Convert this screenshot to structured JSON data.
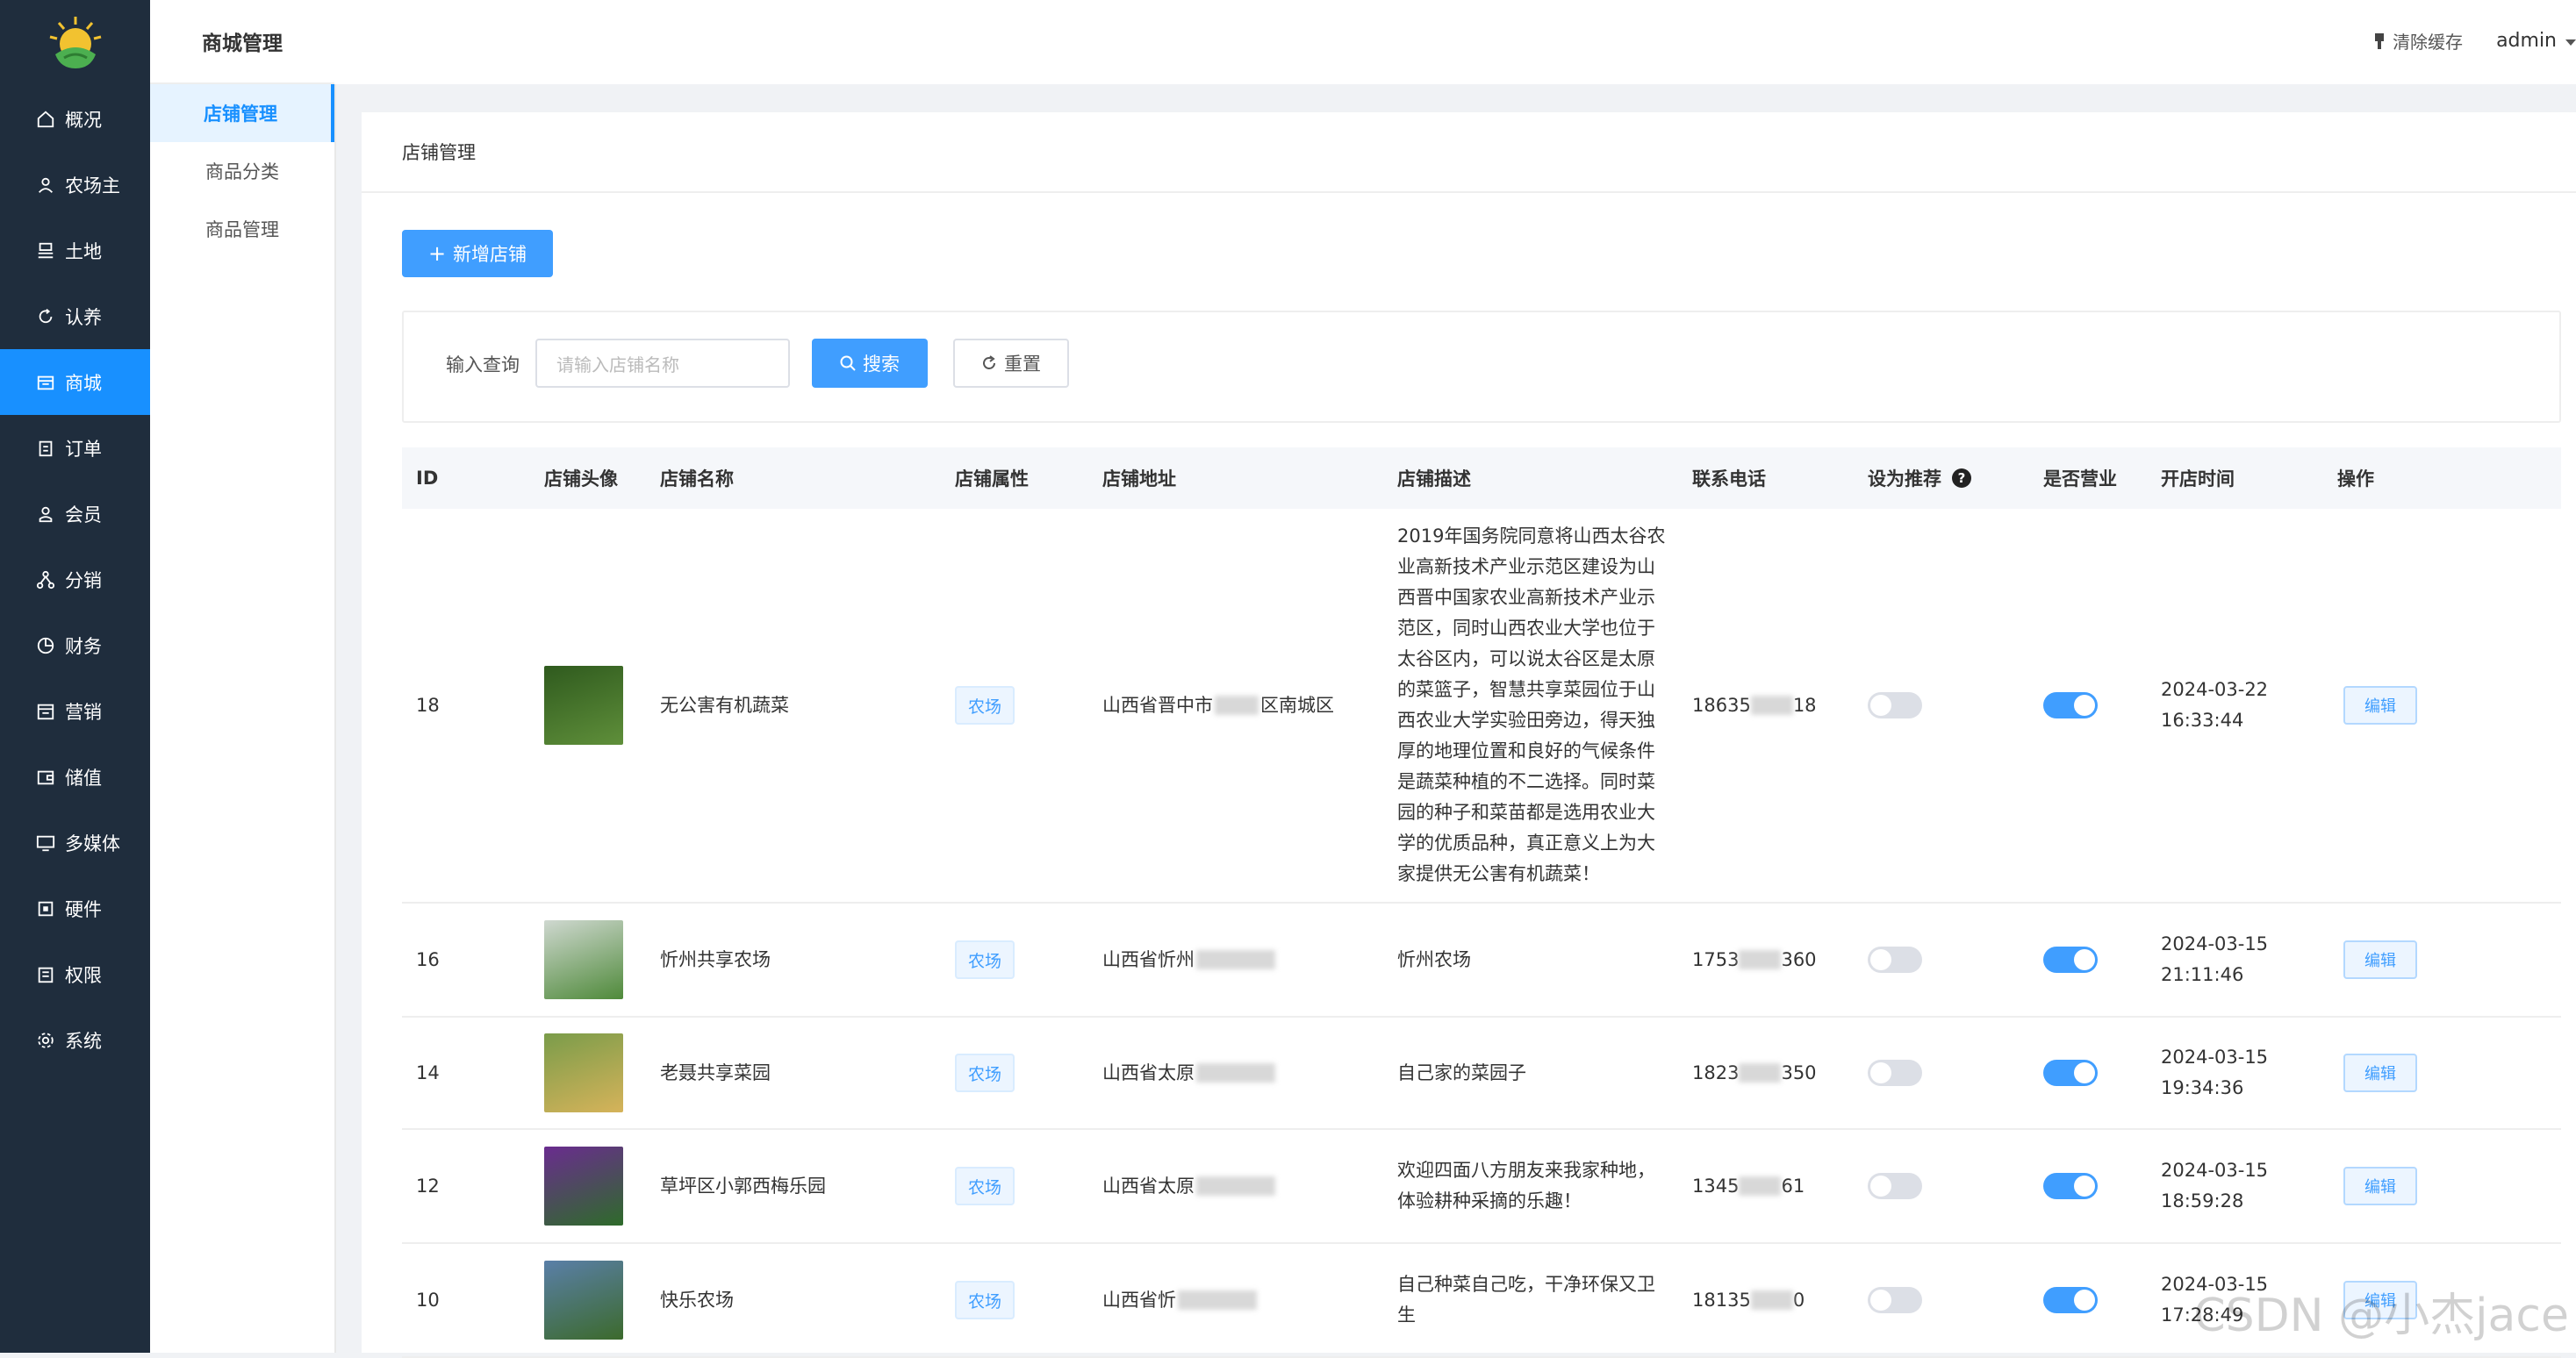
{
  "sidebar": {
    "items": [
      {
        "label": "概况",
        "icon": "home-icon"
      },
      {
        "label": "农场主",
        "icon": "user-icon"
      },
      {
        "label": "土地",
        "icon": "land-icon"
      },
      {
        "label": "认养",
        "icon": "refresh-icon"
      },
      {
        "label": "商城",
        "icon": "shop-icon",
        "active": true
      },
      {
        "label": "订单",
        "icon": "clipboard-icon"
      },
      {
        "label": "会员",
        "icon": "member-icon"
      },
      {
        "label": "分销",
        "icon": "share-icon"
      },
      {
        "label": "财务",
        "icon": "pie-icon"
      },
      {
        "label": "营销",
        "icon": "calendar-icon"
      },
      {
        "label": "储值",
        "icon": "wallet-icon"
      },
      {
        "label": "多媒体",
        "icon": "monitor-icon"
      },
      {
        "label": "硬件",
        "icon": "hardware-icon"
      },
      {
        "label": "权限",
        "icon": "lock-icon"
      },
      {
        "label": "系统",
        "icon": "gear-icon"
      }
    ]
  },
  "subnav": {
    "title": "商城管理",
    "items": [
      {
        "label": "店铺管理",
        "active": true
      },
      {
        "label": "商品分类"
      },
      {
        "label": "商品管理"
      }
    ]
  },
  "topbar": {
    "clear_cache": "清除缓存",
    "user": "admin"
  },
  "page": {
    "title": "店铺管理",
    "add_button": "新增店铺",
    "search": {
      "label": "输入查询",
      "placeholder": "请输入店铺名称",
      "search_button": "搜索",
      "reset_button": "重置"
    }
  },
  "table": {
    "headers": {
      "id": "ID",
      "avatar": "店铺头像",
      "name": "店铺名称",
      "attr": "店铺属性",
      "address": "店铺地址",
      "desc": "店铺描述",
      "phone": "联系电话",
      "recommend": "设为推荐",
      "open": "是否营业",
      "time": "开店时间",
      "ops": "操作"
    },
    "rows": [
      {
        "id": "18",
        "name": "无公害有机蔬菜",
        "attr": "农场",
        "address": "山西省晋中市",
        "address_tail": "区南城区",
        "desc_lines": [
          "2019年国务院同意将山西太谷农",
          "业高新技术产业示范区建设为山",
          "西晋中国家农业高新技术产业示",
          "范区，同时山西农业大学也位于",
          "太谷区内，可以说太谷区是太原",
          "的菜篮子，智慧共享菜园位于山",
          "西农业大学实验田旁边，得天独",
          "厚的地理位置和良好的气候条件",
          "是蔬菜种植的不二选择。同时菜",
          "园的种子和菜苗都是选用农业大",
          "学的优质品种，真正意义上为大",
          "家提供无公害有机蔬菜！"
        ],
        "phone_a": "18635",
        "phone_b": "18",
        "recommend": false,
        "open": true,
        "date": "2024-03-22",
        "time": "16:33:44",
        "edit": "编辑",
        "thumb": [
          "#2f5a1e",
          "#5f8f3a"
        ]
      },
      {
        "id": "16",
        "name": "忻州共享农场",
        "attr": "农场",
        "address": "山西省忻州",
        "address_tail": "",
        "desc_lines": [
          "忻州农场"
        ],
        "phone_a": "1753",
        "phone_b": "360",
        "recommend": false,
        "open": true,
        "date": "2024-03-15",
        "time": "21:11:46",
        "edit": "编辑",
        "thumb": [
          "#cfd8d0",
          "#4f8a3a"
        ]
      },
      {
        "id": "14",
        "name": "老聂共享菜园",
        "attr": "农场",
        "address": "山西省太原",
        "address_tail": "",
        "desc_lines": [
          "自己家的菜园子"
        ],
        "phone_a": "1823",
        "phone_b": "350",
        "recommend": false,
        "open": true,
        "date": "2024-03-15",
        "time": "19:34:36",
        "edit": "编辑",
        "thumb": [
          "#7a9c4a",
          "#d6b35a"
        ]
      },
      {
        "id": "12",
        "name": "草坪区小郭西梅乐园",
        "attr": "农场",
        "address": "山西省太原",
        "address_tail": "",
        "desc_lines": [
          "欢迎四面八方朋友来我家种地，",
          "体验耕种采摘的乐趣！"
        ],
        "phone_a": "1345",
        "phone_b": "61",
        "recommend": false,
        "open": true,
        "date": "2024-03-15",
        "time": "18:59:28",
        "edit": "编辑",
        "thumb": [
          "#6a2c8f",
          "#2e6b2a"
        ]
      },
      {
        "id": "10",
        "name": "快乐农场",
        "attr": "农场",
        "address": "山西省忻",
        "address_tail": "",
        "desc_lines": [
          "自己种菜自己吃，干净环保又卫",
          "生"
        ],
        "phone_a": "18135",
        "phone_b": "0",
        "recommend": false,
        "open": true,
        "date": "2024-03-15",
        "time": "17:28:49",
        "edit": "编辑",
        "thumb": [
          "#5a7fa8",
          "#3c6a2c"
        ]
      }
    ]
  },
  "watermark": "CSDN @小杰jace"
}
